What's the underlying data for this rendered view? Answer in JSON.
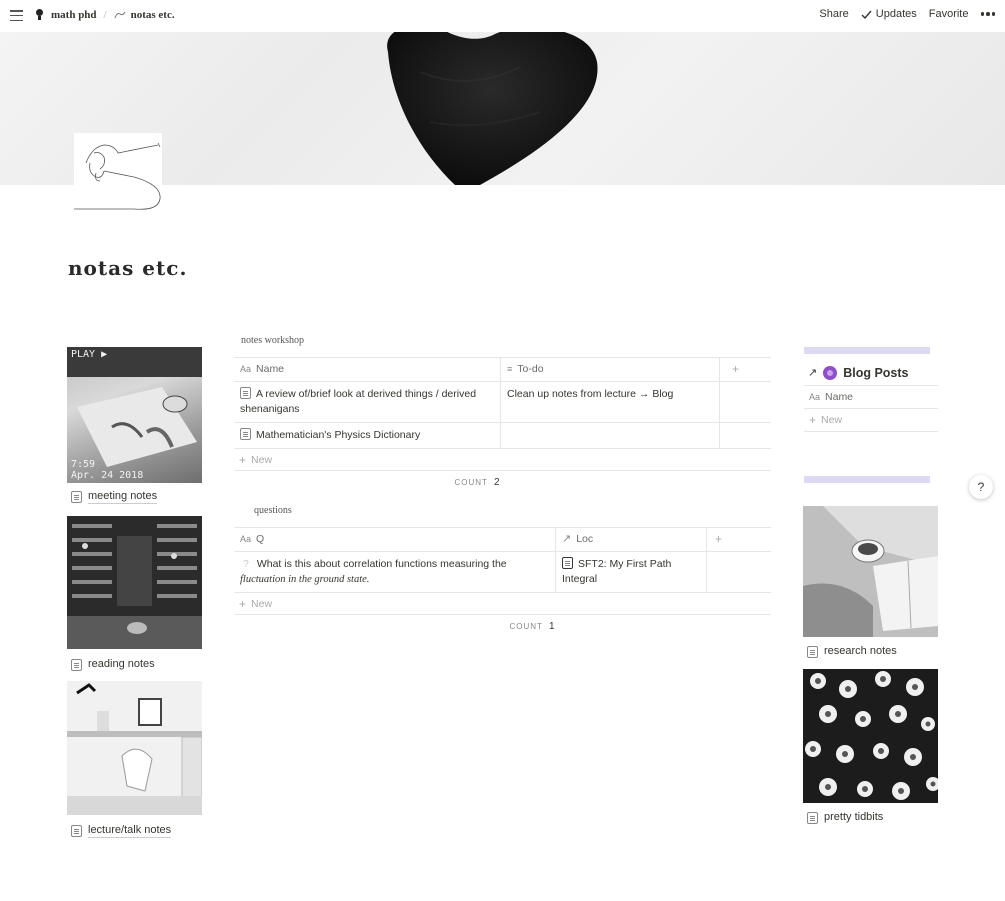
{
  "topbar": {
    "breadcrumbs": [
      {
        "label": "math phd",
        "icon": "bulb-icon"
      },
      {
        "label": "notas etc.",
        "icon": "pen-icon"
      }
    ],
    "separator": "/",
    "share": "Share",
    "updates": "Updates",
    "favorite": "Favorite"
  },
  "page": {
    "title": "notas etc."
  },
  "gallery_left": [
    {
      "label": "meeting notes",
      "overlay_top": "PLAY ▶",
      "overlay_time": "7:59",
      "overlay_date": "Apr. 24 2018"
    },
    {
      "label": "reading notes"
    },
    {
      "label": "lecture/talk notes"
    }
  ],
  "notes_workshop": {
    "title": "notes workshop",
    "columns": [
      "Name",
      "To-do"
    ],
    "rows": [
      {
        "name": "A review of/brief look at derived things / derived shenanigans",
        "todo": "Clean up notes from  lecture → Blog"
      },
      {
        "name": "Mathematician's Physics Dictionary",
        "todo": ""
      }
    ],
    "new_label": "New",
    "count_label": "COUNT",
    "count": "2"
  },
  "questions": {
    "title": "questions",
    "columns": [
      "Q",
      "Loc"
    ],
    "rows": [
      {
        "q": "What is this about correlation functions measuring the",
        "q_italic": "fluctuation in the ground state.",
        "loc": "SFT2: My First Path Integral"
      }
    ],
    "new_label": "New",
    "count_label": "COUNT",
    "count": "1"
  },
  "blog": {
    "title": "Blog Posts",
    "column": "Name",
    "new_label": "New"
  },
  "gallery_right": [
    {
      "label": "research notes"
    },
    {
      "label": "pretty tidbits"
    }
  ],
  "help": "?",
  "colors": {
    "highlight": "#d8d6f2",
    "text": "#37352f",
    "blog_icon": "#8e4fc9"
  }
}
